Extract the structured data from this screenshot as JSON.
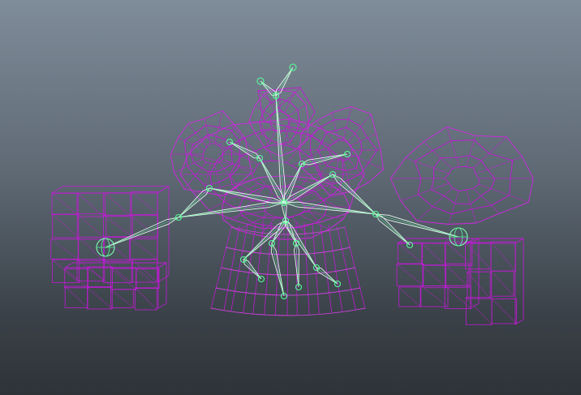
{
  "viewport": {
    "background_top": "#7f8c99",
    "background_bottom": "#2e3338"
  },
  "scene": {
    "mesh_wireframe_color": "#c21ad6",
    "mesh_highlight_color": "#e040f0",
    "joint_color": "#55ff99",
    "bone_color": "#e8fff0",
    "selected_joint_color": "#7dffb0"
  }
}
